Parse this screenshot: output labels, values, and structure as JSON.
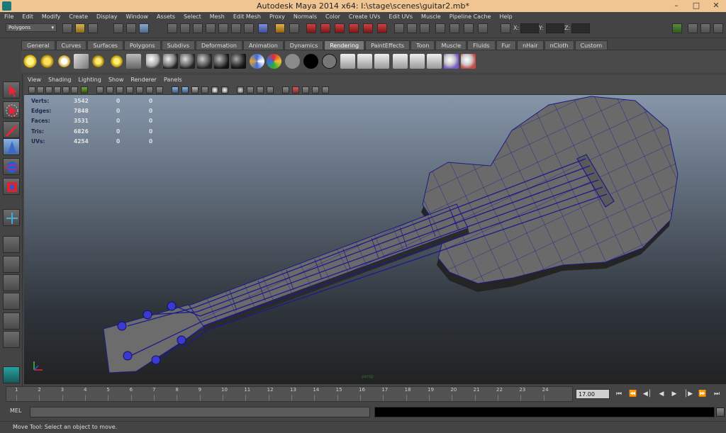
{
  "window": {
    "title": "Autodesk Maya 2014 x64: I:\\stage\\scenes\\guitar2.mb*",
    "minimize": "–",
    "maximize": "□",
    "close": "✕"
  },
  "menu": [
    "File",
    "Edit",
    "Modify",
    "Create",
    "Display",
    "Window",
    "Assets",
    "Select",
    "Mesh",
    "Edit Mesh",
    "Proxy",
    "Normals",
    "Color",
    "Create UVs",
    "Edit UVs",
    "Muscle",
    "Pipeline Cache",
    "Help"
  ],
  "status": {
    "mode": "Polygons",
    "x_label": "X:",
    "y_label": "Y:",
    "z_label": "Z:"
  },
  "shelf_tabs": [
    "General",
    "Curves",
    "Surfaces",
    "Polygons",
    "Subdivs",
    "Deformation",
    "Animation",
    "Dynamics",
    "Rendering",
    "PaintEffects",
    "Toon",
    "Muscle",
    "Fluids",
    "Fur",
    "nHair",
    "nCloth",
    "Custom"
  ],
  "active_shelf": "Rendering",
  "panel_menu": [
    "View",
    "Shading",
    "Lighting",
    "Show",
    "Renderer",
    "Panels"
  ],
  "hud": {
    "rows": [
      {
        "label": "Verts:",
        "v1": "3542",
        "v2": "0",
        "v3": "0"
      },
      {
        "label": "Edges:",
        "v1": "7848",
        "v2": "0",
        "v3": "0"
      },
      {
        "label": "Faces:",
        "v1": "3531",
        "v2": "0",
        "v3": "0"
      },
      {
        "label": "Tris:",
        "v1": "6826",
        "v2": "0",
        "v3": "0"
      },
      {
        "label": "UVs:",
        "v1": "4254",
        "v2": "0",
        "v3": "0"
      }
    ]
  },
  "camera_label": "persp",
  "timeline": {
    "ticks": [
      "1",
      "2",
      "3",
      "4",
      "5",
      "6",
      "7",
      "8",
      "9",
      "10",
      "11",
      "12",
      "13",
      "14",
      "15",
      "16",
      "17",
      "18",
      "19",
      "20",
      "21",
      "22",
      "23",
      "24"
    ],
    "current_time": "17.00"
  },
  "playback": [
    "⏮",
    "⏪",
    "◀│",
    "◀",
    "▶",
    "│▶",
    "⏩",
    "⏭"
  ],
  "cmdline": {
    "label": "MEL"
  },
  "help_line": "Move Tool: Select an object to move.",
  "colors": {
    "wire": "#1b1b8a",
    "mesh": "#6a6a6a",
    "titlebar": "#f0c592"
  }
}
